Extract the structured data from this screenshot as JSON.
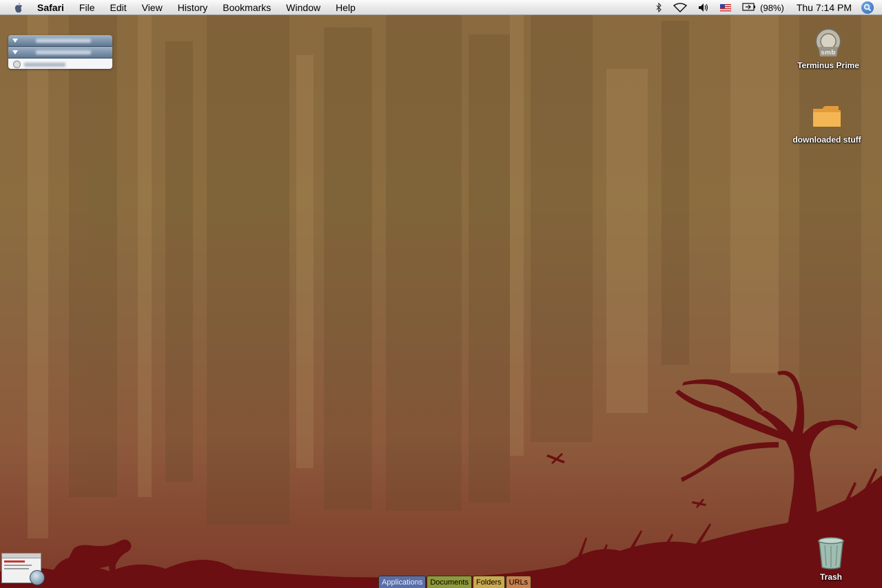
{
  "menubar": {
    "app_name": "Safari",
    "items": [
      "File",
      "Edit",
      "View",
      "History",
      "Bookmarks",
      "Window",
      "Help"
    ],
    "battery": "(98%)",
    "clock": "Thu 7:14 PM",
    "icons": [
      "apple-icon",
      "bluetooth-icon",
      "wifi-icon",
      "volume-icon",
      "us-flag-icon",
      "battery-icon",
      "spotlight-icon"
    ]
  },
  "desktop_icons": {
    "server": {
      "label": "Terminus Prime",
      "icon": "smb-server-icon"
    },
    "folder": {
      "label": "downloaded stuff",
      "icon": "folder-icon"
    },
    "trash": {
      "label": "Trash",
      "icon": "trash-icon"
    }
  },
  "tabs": [
    {
      "label": "Applications",
      "color": "#5a6ea8"
    },
    {
      "label": "Documents",
      "color": "#8e9a3a"
    },
    {
      "label": "Folders",
      "color": "#c9a94e"
    },
    {
      "label": "URLs",
      "color": "#c8804e"
    }
  ],
  "colors": {
    "silhouette": "#6b0f12",
    "wallpaper_top": "#8a6a3f",
    "wallpaper_bottom": "#7e3a2a"
  }
}
